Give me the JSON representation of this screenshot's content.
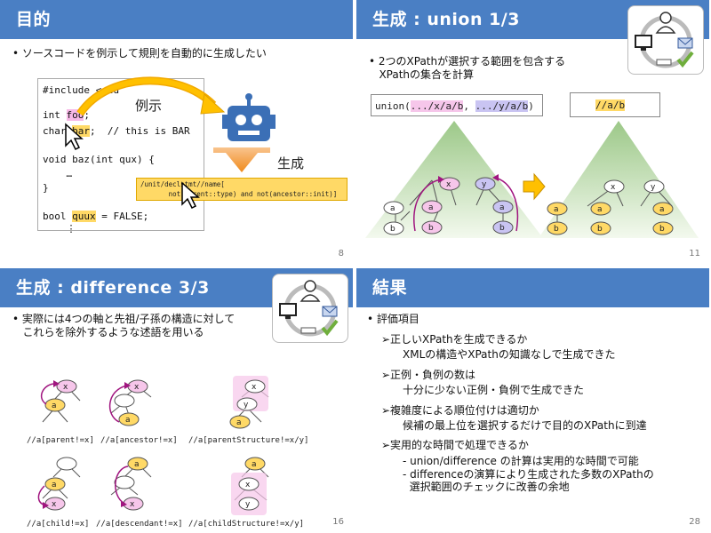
{
  "slides": [
    {
      "title": "目的",
      "page": "8",
      "bullet": "• ソースコードを例示して規則を自動的に生成したい",
      "code_lines": [
        "#include <std",
        "int foo;",
        "char bar;  // this is BAR",
        "void baz(int qux) {",
        "    …",
        "}",
        "bool quux = FALSE;",
        "    ⋮"
      ],
      "label_example": "例示",
      "label_generate": "生成",
      "rule_lines": [
        "/unit/declstmt//name[",
        "       not(parent::type) and not(ancestor::init)]"
      ]
    },
    {
      "title": "生成 : union 1/3",
      "page": "11",
      "bullet_lines": [
        "• 2つのXPathが選択する範囲を包含する",
        "   XPathの集合を計算"
      ],
      "union_prefix": "union(",
      "union_arg1": ".../x/a/b",
      "union_sep": ", ",
      "union_arg2": ".../y/a/b",
      "union_suffix": ")",
      "result": "//a/b"
    },
    {
      "title": "生成 : difference 3/3",
      "page": "16",
      "bullet_lines": [
        "• 実際には4つの軸と先祖/子孫の構造に対して",
        "   これらを除外するような述語を用いる"
      ],
      "captions_top": [
        "//a[parent!=x]",
        "//a[ancestor!=x]",
        "//a[parentStructure!=x/y]"
      ],
      "captions_bottom": [
        "//a[child!=x]",
        "//a[descendant!=x]",
        "//a[childStructure!=x/y]"
      ]
    },
    {
      "title": "結果",
      "page": "28",
      "heading": "• 評価項目",
      "items": [
        {
          "q": "➢正しいXPathを生成できるか",
          "a": "XMLの構造やXPathの知識なしで生成できた"
        },
        {
          "q": "➢正例・負例の数は",
          "a": "十分に少ない正例・負例で生成できた"
        },
        {
          "q": "➢複雑度による順位付けは適切か",
          "a": "候補の最上位を選択するだけで目的のXPathに到達"
        },
        {
          "q": "➢実用的な時間で処理できるか",
          "a": ""
        }
      ],
      "sub_items": [
        "- union/difference の計算は実用的な時間で可能",
        "- differenceの演算により生成された多数のXPathの",
        "  選択範囲のチェックに改善の余地"
      ]
    }
  ],
  "colors": {
    "header": "#4a7fc4",
    "pink": "#f6c6ea",
    "yellow": "#ffd966",
    "purple": "#c9c4f2",
    "green_tri": "#cfe3c4"
  },
  "icons": [
    "cursor-icon",
    "robot-icon",
    "arrow-icon",
    "computer-icon",
    "user-icon",
    "mail-icon",
    "check-icon"
  ]
}
